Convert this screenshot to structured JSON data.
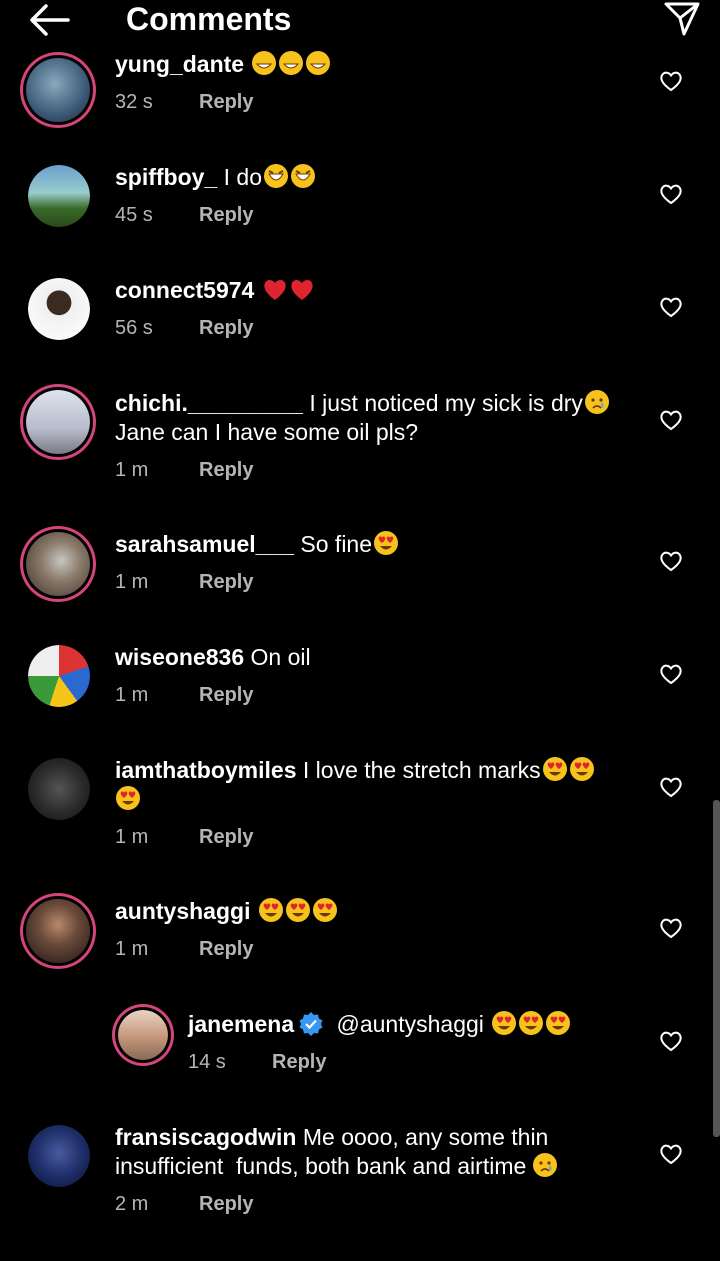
{
  "header": {
    "title": "Comments"
  },
  "comments": [
    {
      "username": "yung_dante",
      "text": "",
      "emoji": [
        "grin",
        "grin",
        "grin"
      ],
      "time": "32 s",
      "reply": "Reply",
      "avatar_color": "#3b5a78"
    },
    {
      "username": "spiffboy_",
      "text": "I do",
      "emoji": [
        "tears",
        "tears"
      ],
      "time": "45 s",
      "reply": "Reply",
      "avatar_color": "#4a7a3a"
    },
    {
      "username": "connect5974",
      "text": "",
      "emoji": [
        "heart",
        "heart"
      ],
      "time": "56 s",
      "reply": "Reply",
      "avatar_color": "#e8e8e8"
    },
    {
      "username": "chichi._________",
      "text": "I just noticed my sick is dry",
      "text2": "Jane can I have some oil pls?",
      "emoji": [
        "cry"
      ],
      "time": "1 m",
      "reply": "Reply",
      "avatar_color": "#c9c9d6"
    },
    {
      "username": "sarahsamuel___",
      "text": "So fine",
      "emoji": [
        "hearteyes"
      ],
      "time": "1 m",
      "reply": "Reply",
      "avatar_color": "#5a4a3a"
    },
    {
      "username": "wiseone836",
      "text": "On oil",
      "emoji": [],
      "time": "1 m",
      "reply": "Reply",
      "avatar_color": "#b83a3a"
    },
    {
      "username": "iamthatboymiles",
      "text": "I love the stretch marks",
      "emoji": [
        "hearteyes",
        "hearteyes",
        "hearteyes"
      ],
      "time": "1 m",
      "reply": "Reply",
      "avatar_color": "#2a2a2a"
    },
    {
      "username": "auntyshaggi",
      "text": "",
      "emoji": [
        "hearteyes",
        "hearteyes",
        "hearteyes"
      ],
      "time": "1 m",
      "reply": "Reply",
      "avatar_color": "#3a2a22"
    },
    {
      "username": "janemena",
      "text": "@auntyshaggi",
      "emoji": [
        "hearteyes",
        "hearteyes",
        "hearteyes"
      ],
      "time": "14 s",
      "reply": "Reply",
      "avatar_color": "#d9b7a0",
      "verified": true
    },
    {
      "username": "fransiscagodwin",
      "text": "Me oooo, any some thin",
      "text2": "insufficient  funds, both bank and airtime",
      "emoji": [
        "cry"
      ],
      "time": "2 m",
      "reply": "Reply",
      "avatar_color": "#1f2f6a"
    }
  ],
  "colors": {
    "background": "#000000",
    "meta": "#b5b5b5",
    "story_ring": "#d4457a",
    "verified": "#3897f0"
  }
}
